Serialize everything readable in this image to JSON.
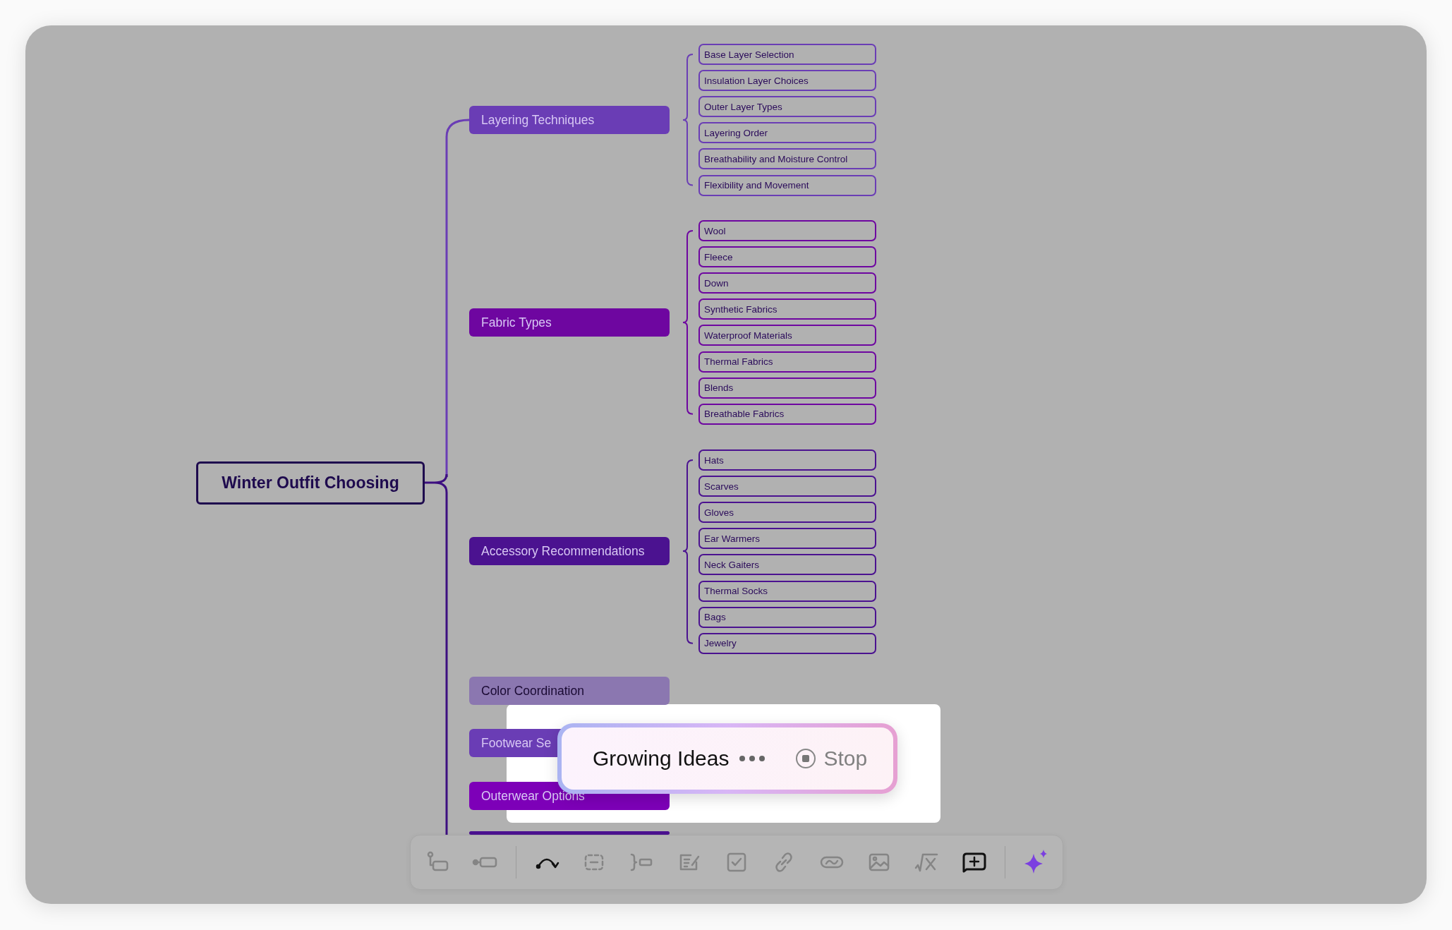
{
  "root": {
    "label": "Winter Outfit Choosing"
  },
  "branches": [
    {
      "label": "Layering Techniques",
      "color": "#6a3db5",
      "children": [
        {
          "label": "Base Layer Selection"
        },
        {
          "label": "Insulation Layer Choices"
        },
        {
          "label": "Outer Layer Types"
        },
        {
          "label": "Layering Order"
        },
        {
          "label": "Breathability and Moisture Control"
        },
        {
          "label": "Flexibility and Movement"
        }
      ]
    },
    {
      "label": "Fabric Types",
      "color": "#6e06a0",
      "children": [
        {
          "label": "Wool"
        },
        {
          "label": "Fleece"
        },
        {
          "label": "Down"
        },
        {
          "label": "Synthetic Fabrics"
        },
        {
          "label": "Waterproof Materials"
        },
        {
          "label": "Thermal Fabrics"
        },
        {
          "label": "Blends"
        },
        {
          "label": "Breathable Fabrics"
        }
      ]
    },
    {
      "label": "Accessory Recommendations",
      "color": "#4b1290",
      "children": [
        {
          "label": "Hats"
        },
        {
          "label": "Scarves"
        },
        {
          "label": "Gloves"
        },
        {
          "label": "Ear Warmers"
        },
        {
          "label": "Neck Gaiters"
        },
        {
          "label": "Thermal Socks"
        },
        {
          "label": "Bags"
        },
        {
          "label": "Jewelry"
        }
      ]
    },
    {
      "label": "Color Coordination",
      "color": "#8b77b0"
    },
    {
      "label": "Footwear Se",
      "color": "#6a3db5"
    },
    {
      "label": "Outerwear Options",
      "color": "#7d00b8"
    },
    {
      "color": "#4b1290"
    }
  ],
  "progress": {
    "status": "Growing Ideas",
    "action": "Stop"
  },
  "toolbar": [
    {
      "kind": "subtopic",
      "disabled": true
    },
    {
      "kind": "sibling",
      "disabled": true
    },
    {
      "kind": "curve",
      "disabled": false
    },
    {
      "kind": "boundary",
      "disabled": true
    },
    {
      "kind": "summary",
      "disabled": true
    },
    {
      "kind": "note",
      "disabled": true
    },
    {
      "kind": "todo",
      "disabled": true
    },
    {
      "kind": "link",
      "disabled": true
    },
    {
      "kind": "relation",
      "disabled": true
    },
    {
      "kind": "image",
      "disabled": true
    },
    {
      "kind": "formula",
      "disabled": true
    },
    {
      "kind": "add",
      "disabled": false
    },
    {
      "kind": "ai"
    }
  ]
}
